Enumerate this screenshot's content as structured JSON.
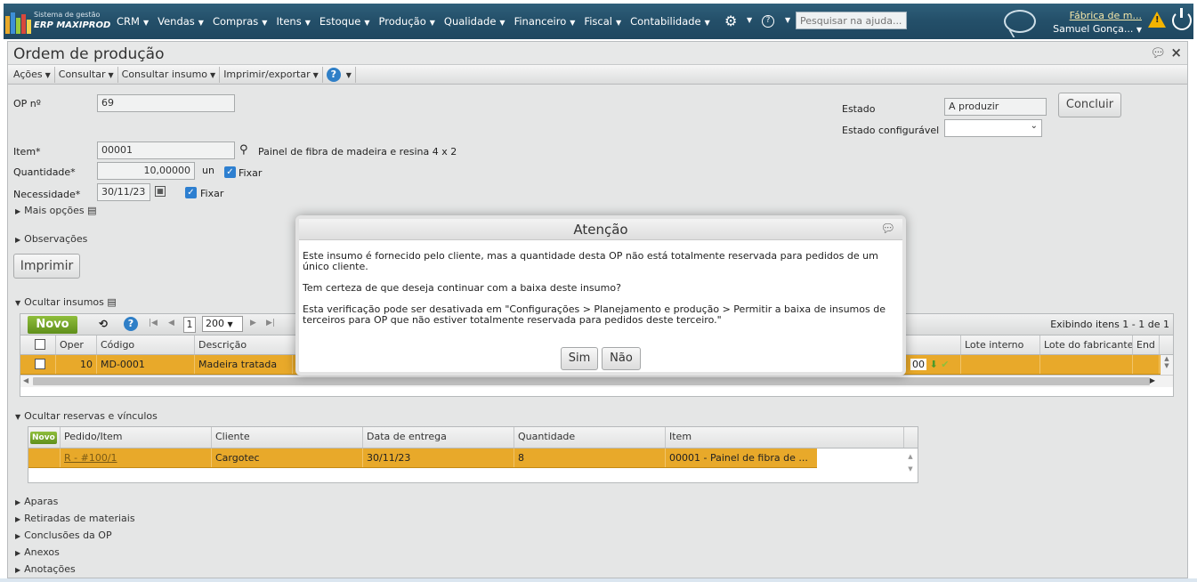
{
  "topbar": {
    "brand_line1": "Sistema de gestão",
    "brand_line2": "ERP MAXIPROD",
    "menu": [
      "CRM",
      "Vendas",
      "Compras",
      "Itens",
      "Estoque",
      "Produção",
      "Qualidade",
      "Financeiro",
      "Fiscal",
      "Contabilidade"
    ],
    "search_placeholder": "Pesquisar na ajuda...",
    "company": "Fábrica de m...",
    "user": "Samuel Gonça...",
    "colors": {
      "bar": "#24506a",
      "accent_orange": "#e8a92a",
      "novo_green": "#6f9f24"
    }
  },
  "window": {
    "title": "Ordem de produção",
    "toolbar": [
      "Ações",
      "Consultar",
      "Consultar insumo",
      "Imprimir/exportar"
    ]
  },
  "form": {
    "op_label": "OP nº",
    "op_value": "69",
    "estado_label": "Estado",
    "estado_value": "A produzir",
    "estado_config_label": "Estado configurável",
    "concluir": "Concluir",
    "item_label": "Item*",
    "item_value": "00001",
    "item_desc": "Painel de fibra de madeira e resina 4 x 2",
    "qtd_label": "Quantidade*",
    "qtd_value": "10,00000",
    "qtd_unit": "un",
    "fixar": "Fixar",
    "nec_label": "Necessidade*",
    "nec_value": "30/11/23",
    "mais_opcoes": "Mais opções",
    "observacoes": "Observações",
    "imprimir": "Imprimir"
  },
  "insumos": {
    "section": "Ocultar insumos",
    "novo": "Novo",
    "page": "1",
    "page_size": "200",
    "exibindo": "Exibindo itens 1 - 1 de 1",
    "headers": [
      "Oper",
      "Código",
      "Descrição",
      "Lote interno",
      "Lote do fabricante",
      "End"
    ],
    "row": {
      "oper": "10",
      "codigo": "MD-0001",
      "descricao": "Madeira tratada",
      "qtd_tail": "00"
    }
  },
  "reservas": {
    "section": "Ocultar reservas e vínculos",
    "novo": "Novo",
    "headers": [
      "Pedido/Item",
      "Cliente",
      "Data de entrega",
      "Quantidade",
      "Item"
    ],
    "row": {
      "pedido": "R - #100/1",
      "cliente": "Cargotec",
      "data": "30/11/23",
      "quantidade": "8",
      "item": "00001 - Painel de fibra de ..."
    }
  },
  "sections": [
    "Aparas",
    "Retiradas de materiais",
    "Conclusões da OP",
    "Anexos",
    "Anotações"
  ],
  "modal": {
    "title": "Atenção",
    "p1": "Este insumo é fornecido pelo cliente, mas a quantidade desta OP não está totalmente reservada para pedidos de um único cliente.",
    "p2": "Tem certeza de que deseja continuar com a baixa deste insumo?",
    "p3": "Esta verificação pode ser desativada em \"Configurações > Planejamento e produção > Permitir a baixa de insumos de terceiros para OP que não estiver totalmente reservada para pedidos deste terceiro.\"",
    "sim": "Sim",
    "nao": "Não"
  }
}
